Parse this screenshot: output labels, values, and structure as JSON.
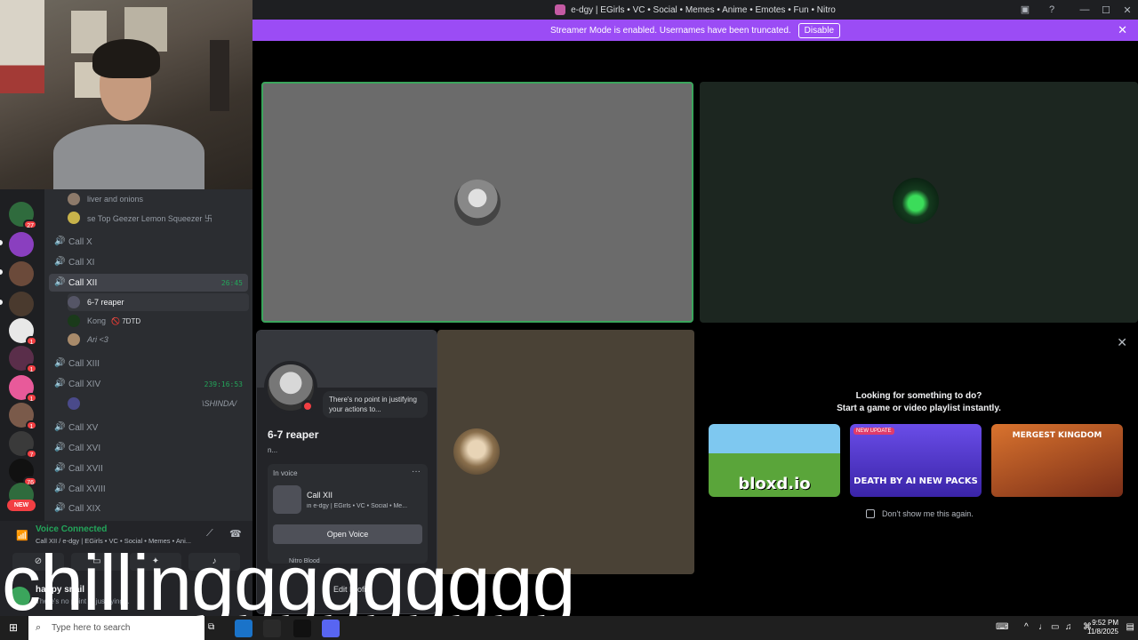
{
  "window": {
    "title": "e-dgy | EGirls • VC • Social • Memes • Anime • Emotes • Fun • Nitro"
  },
  "streamer_bar": {
    "text": "Streamer Mode is enabled. Usernames have been truncated.",
    "button": "Disable"
  },
  "servers": {
    "badges": [
      "27",
      "1",
      "1",
      "1",
      "1",
      "1",
      "7",
      "76",
      "1"
    ],
    "new_label": "NEW"
  },
  "channels": {
    "pre_users": [
      {
        "name": "liver and onions"
      },
      {
        "name": "se Top Geezer Lemon Squeezer 卐"
      }
    ],
    "items": [
      {
        "label": "Call X"
      },
      {
        "label": "Call XI"
      },
      {
        "label": "Call XII",
        "timer": "26:45"
      },
      {
        "label": "Call XIII"
      },
      {
        "label": "Call XIV",
        "timer": "239:16:53"
      },
      {
        "label": "Call XV"
      },
      {
        "label": "Call XVI"
      },
      {
        "label": "Call XVII"
      },
      {
        "label": "Call XVIII"
      },
      {
        "label": "Call XIX"
      }
    ],
    "call12_users": [
      {
        "name": "6-7 reaper"
      },
      {
        "name": "Kong",
        "tag": "🚫 7DTD"
      },
      {
        "name": "Ari <3"
      }
    ],
    "call14_users": [
      {
        "name": "\\SHINDA/"
      }
    ]
  },
  "voice": {
    "status": "Voice Connected",
    "subtitle": "Call XII / e-dgy | EGirls • VC • Social • Memes • Ani..."
  },
  "user": {
    "name": "happy snail",
    "status": "There's no point in justifying..."
  },
  "profile": {
    "bubble": "There's no point in justifying your actions to...",
    "name": "6-7 reaper",
    "username": "n...",
    "in_voice": "In voice",
    "channel": "Call XII",
    "channel_sub": "in e-dgy | EGirls • VC • Social • Me...",
    "open_voice": "Open Voice",
    "nitro": "Nitro Blood",
    "edit": "Edit Profile"
  },
  "activity": {
    "heading1": "Looking for something to do?",
    "heading2": "Start a game or video playlist instantly.",
    "games": [
      {
        "title": "bloxd.io",
        "color": "#5aa53a"
      },
      {
        "title": "DEATH BY AI NEW PACKS",
        "badge": "NEW UPDATE",
        "color": "#5a3fd6"
      },
      {
        "title": "MERGEST KINGDOM",
        "color": "#b8502e"
      }
    ],
    "checkbox_label": "Don't show me this again."
  },
  "caption": "chillinggggggggg",
  "taskbar": {
    "search_placeholder": "Type here to search",
    "time": "9:52 PM",
    "date": "11/8/2025"
  },
  "colors": {
    "accent": "#9b4cf5",
    "online": "#23a55a",
    "dnd": "#f23f43"
  }
}
